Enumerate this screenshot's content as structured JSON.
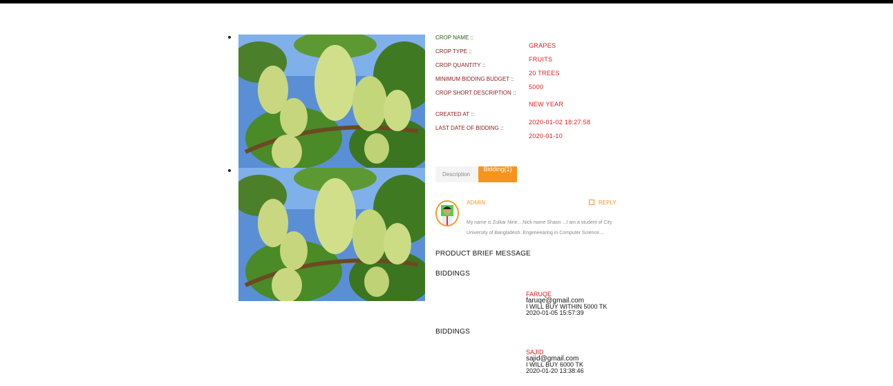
{
  "crop": {
    "labels": {
      "name": "CROP NAME ::",
      "type": "CROP TYPE ::",
      "quantity": "CROP QUANTITY ::",
      "budget": "MINIMUM BIDDING BUDGET ::",
      "description": "CROP SHORT DESCRIPTION ::",
      "created": "CREATED AT ::",
      "last_date": "LAST DATE OF BIDDING ::"
    },
    "values": {
      "name": "GRAPES",
      "type": "FRUITS",
      "quantity": "20 TREES",
      "budget": "5000",
      "description": "NEW YEAR",
      "created": "2020-01-02 18:27:58",
      "last_date": "2020-01-10"
    }
  },
  "tabs": {
    "description": "Description",
    "bidding": "Bidding(1)"
  },
  "comment": {
    "author": "ADMIN",
    "reply": "REPLY",
    "text": "My name is Zulkar Nine....Nick name Shaon ...I am a student of City University of Bangladesh..Engeneearing in Computer Science...."
  },
  "brief_title": "PRODUCT BRIEF MESSAGE",
  "biddings": [
    {
      "heading": "BIDDINGS",
      "name": "FARUQE",
      "email": "faruqe@gmail.com",
      "message": "I WILL BUY WITHIN 5000 TK",
      "date": "2020-01-05 15:57:39"
    },
    {
      "heading": "BIDDINGS",
      "name": "SAJID",
      "email": "sajid@gmail.com",
      "message": "I WILL BUY 6000 TK",
      "date": "2020-01-20 13:38:46"
    }
  ],
  "icons": {
    "photo": "grapes-photo",
    "avatar": "user-avatar",
    "reply": "reply-icon"
  },
  "colors": {
    "accent": "#f7941d",
    "value_red": "#e0191e",
    "label_red": "#8b1a1a"
  }
}
